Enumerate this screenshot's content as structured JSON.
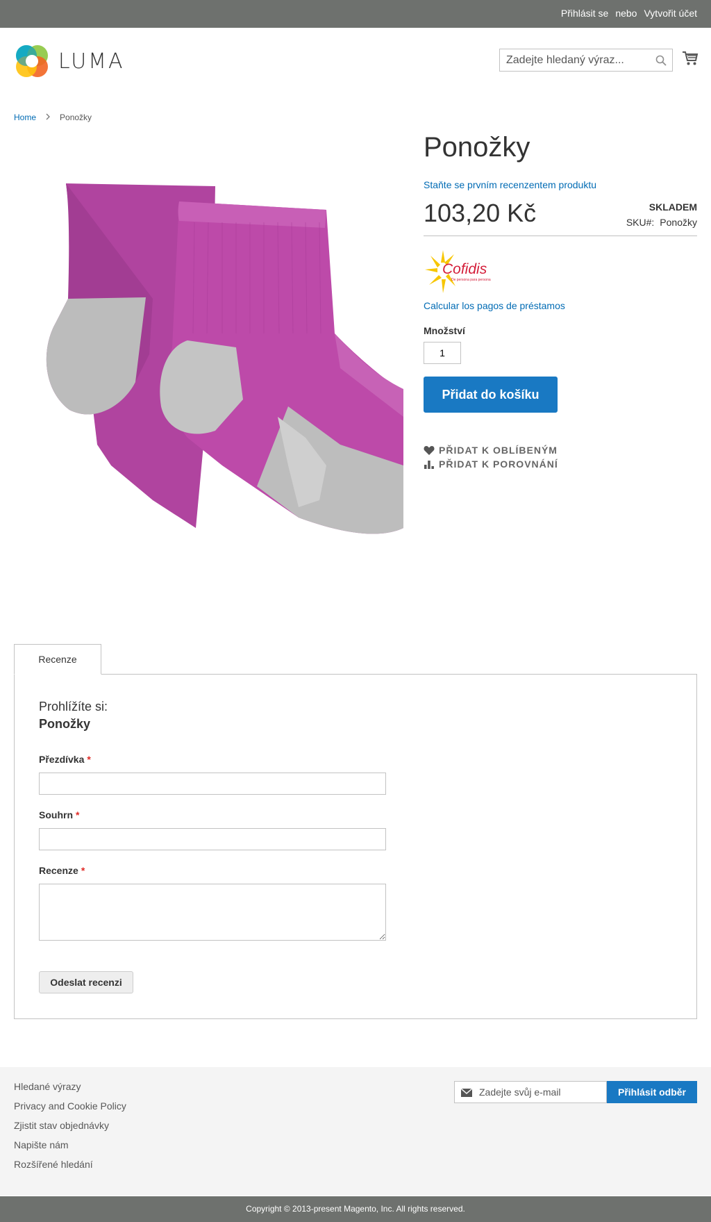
{
  "topbar": {
    "signin": "Přihlásit se",
    "or": "nebo",
    "create_account": "Vytvořit účet"
  },
  "header": {
    "logo_text": "LUMA",
    "search_placeholder": "Zadejte hledaný výraz..."
  },
  "breadcrumb": {
    "home": "Home",
    "current": "Ponožky"
  },
  "product": {
    "title": "Ponožky",
    "review_link": "Staňte se prvním recenzentem produktu",
    "price": "103,20 Kč",
    "stock": "SKLADEM",
    "sku_label": "SKU#:",
    "sku_value": "Ponožky",
    "cofidis_brand": "Cofidis",
    "cofidis_tagline": "De persona para persona",
    "calc_link": "Calcular los pagos de préstamos",
    "qty_label": "Množství",
    "qty_value": "1",
    "add_to_cart": "Přidat do košíku",
    "wishlist": "PŘIDAT K OBLÍBENÝM",
    "compare": "PŘIDAT K POROVNÁNÍ"
  },
  "tabs": {
    "reviews_tab": "Recenze"
  },
  "review_form": {
    "heading": "Prohlížíte si:",
    "product_name": "Ponožky",
    "nickname_label": "Přezdívka",
    "summary_label": "Souhrn",
    "review_label": "Recenze",
    "required_mark": "*",
    "submit": "Odeslat recenzi"
  },
  "footer": {
    "links": [
      "Hledané výrazy",
      "Privacy and Cookie Policy",
      "Zjistit stav objednávky",
      "Napište nám",
      "Rozšířené hledání"
    ],
    "newsletter_placeholder": "Zadejte svůj e-mail",
    "newsletter_button": "Přihlásit odběr",
    "copyright": "Copyright © 2013-present Magento, Inc. All rights reserved."
  },
  "colors": {
    "accent": "#1979c3",
    "link": "#006bb4",
    "topbar": "#6e716e",
    "sock_purple": "#b0449f",
    "sock_grey": "#b9b9b9"
  }
}
